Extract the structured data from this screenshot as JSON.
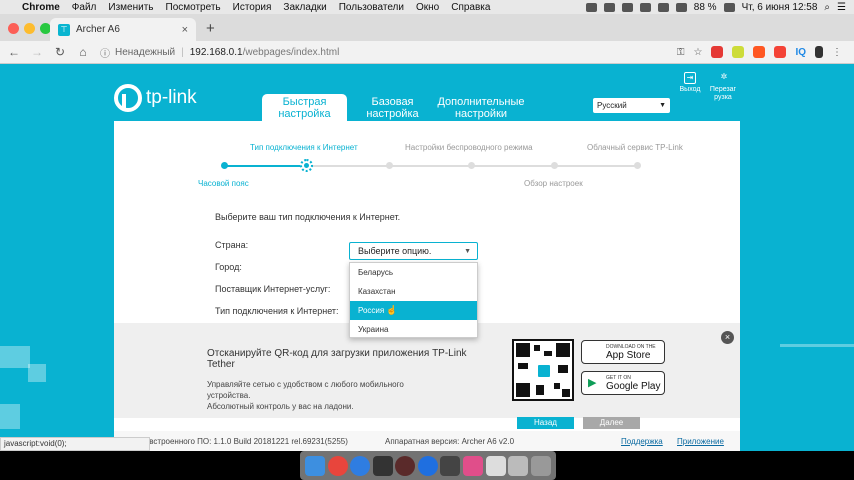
{
  "menubar": {
    "app": "Chrome",
    "items": [
      "Файл",
      "Изменить",
      "Посмотреть",
      "История",
      "Закладки",
      "Пользователи",
      "Окно",
      "Справка"
    ],
    "battery": "88 %",
    "datetime": "Чт, 6 июня  12:58"
  },
  "browser": {
    "tab_title": "Archer A6",
    "tab_icon": "tp-link-favicon",
    "insecure_label": "Ненадежный",
    "url_host": "192.168.0.1",
    "url_path": "/webpages/index.html",
    "extensions": [
      "key-icon",
      "star-icon",
      "adblock-icon",
      "ext-icon",
      "ext-icon",
      "ext-icon",
      "iq-icon",
      "battery-icon",
      "menu-icon"
    ],
    "status_url": "javascript:void(0);"
  },
  "router": {
    "brand": "tp-link",
    "nav_tabs": [
      {
        "label": "Быстрая настройка"
      },
      {
        "label": "Базовая настройка"
      },
      {
        "label": "Дополнительные настройки"
      }
    ],
    "language": "Русский",
    "top_icons": [
      {
        "label": "Выход"
      },
      {
        "label": "Перезагрузка"
      }
    ],
    "steps_top": [
      "Тип подключения к Интернет",
      "Настройки беспроводного режима",
      "Облачный сервис TP-Link"
    ],
    "steps_bottom": [
      "Часовой пояс",
      "Обзор настроек"
    ],
    "form": {
      "intro": "Выберите ваш тип подключения к Интернет.",
      "country_label": "Страна:",
      "city_label": "Город:",
      "isp_label": "Поставщик Интернет-услуг:",
      "conn_type_label": "Тип подключения к Интернет:",
      "country_placeholder": "Выберите опцию.",
      "country_options": [
        "Беларусь",
        "Казахстан",
        "Россия",
        "Украина"
      ],
      "highlighted_option": "Россия"
    },
    "promo": {
      "title": "Отсканируйте QR-код для загрузки приложения TP-Link Tether",
      "subtitle1": "Управляйте сетью с удобством с любого мобильного устройства.",
      "subtitle2": "Абсолютный контроль у вас на ладони.",
      "appstore_small": "DOWNLOAD ON THE",
      "appstore_big": "App Store",
      "googleplay_small": "GET IT ON",
      "googleplay_big": "Google Play"
    },
    "buttons": {
      "back": "Назад",
      "next": "Далее"
    },
    "footer": {
      "firmware": "Версия встроенного ПО: 1.1.0 Build 20181221 rel.69231(5255)",
      "hardware": "Аппаратная версия: Archer A6 v2.0",
      "support": "Поддержка",
      "app": "Приложение"
    }
  }
}
